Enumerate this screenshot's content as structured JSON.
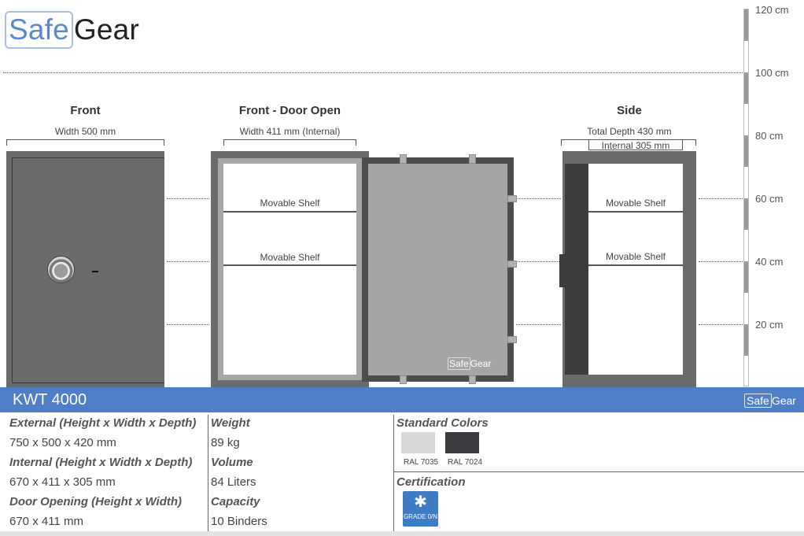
{
  "brand": {
    "safe": "Safe",
    "gear": "Gear"
  },
  "scale": {
    "labels": [
      "120 cm",
      "100 cm",
      "80 cm",
      "60 cm",
      "40 cm",
      "20 cm"
    ]
  },
  "views": {
    "front": {
      "title": "Front",
      "width_label": "Width 500 mm"
    },
    "open": {
      "title": "Front - Door Open",
      "width_label": "Width 411 mm (Internal)"
    },
    "side": {
      "title": "Side",
      "depth_label": "Total Depth 430 mm",
      "internal_label": "Internal 305 mm"
    }
  },
  "shelves": {
    "label": "Movable Shelf"
  },
  "model": {
    "name": "KWT 4000"
  },
  "specs": {
    "external_label": "External",
    "external_sub": "(Height x Width x Depth)",
    "external_value": "750 x 500 x 420 mm",
    "internal_label": "Internal",
    "internal_sub": "(Height x Width x Depth)",
    "internal_value": "670 x 411 x 305 mm",
    "door_label": "Door Opening",
    "door_sub": "(Height x Width)",
    "door_value": "670 x 411 mm",
    "weight_label": "Weight",
    "weight_value": "89 kg",
    "volume_label": "Volume",
    "volume_value": "84 Liters",
    "capacity_label": "Capacity",
    "capacity_value": "10 Binders"
  },
  "colors": {
    "title": "Standard Colors",
    "items": [
      {
        "name": "RAL 7035",
        "hex": "#d8d8d8"
      },
      {
        "name": "RAL 7024",
        "hex": "#3b3b3f"
      }
    ]
  },
  "certification": {
    "title": "Certification",
    "badge_text": "GRADE 0/N"
  }
}
